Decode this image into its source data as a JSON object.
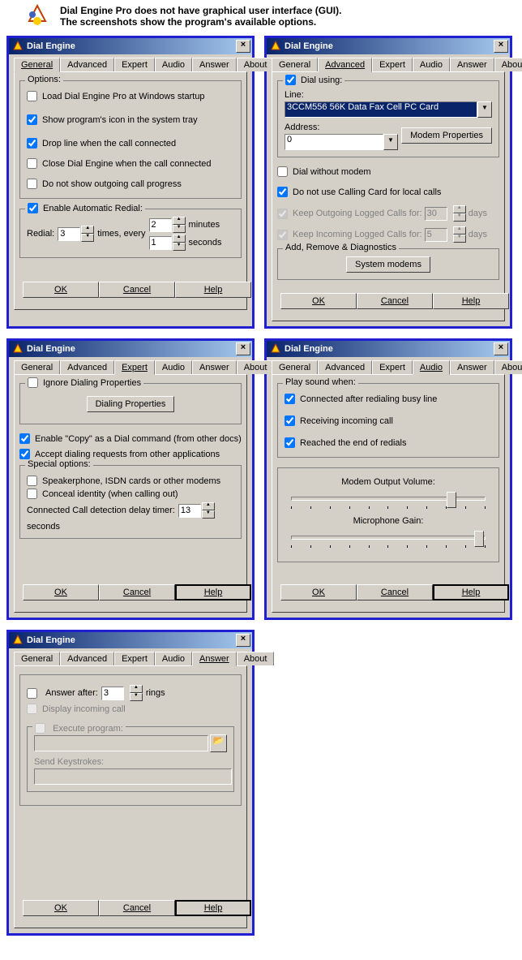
{
  "header": {
    "line1": "Dial Engine Pro does not have graphical user interface (GUI).",
    "line2": "The screenshots show the program's available options."
  },
  "tabs": {
    "general": "General",
    "advanced": "Advanced",
    "expert": "Expert",
    "audio": "Audio",
    "answer": "Answer",
    "about": "About"
  },
  "title": "Dial Engine",
  "buttons": {
    "ok": "OK",
    "cancel": "Cancel",
    "help": "Help"
  },
  "d1": {
    "options_title": "Options:",
    "load": "Load Dial Engine Pro at Windows startup",
    "tray": "Show program's icon in the system tray",
    "dropline": "Drop line when the call connected",
    "close": "Close Dial Engine when the call connected",
    "noshow": "Do not show outgoing call progress",
    "redial_title": "Enable Automatic Redial:",
    "redial_pre": "Redial:",
    "redial_times": "times,  every",
    "minutes": "minutes",
    "seconds": "seconds",
    "redial_count": "3",
    "redial_min": "2",
    "redial_sec": "1"
  },
  "d2": {
    "dialusing": "Dial using:",
    "line": "Line:",
    "line_val": "3CCM556 56K Data Fax Cell PC Card",
    "address": "Address:",
    "address_val": "0",
    "modem_props": "Modem Properties",
    "without": "Dial without modem",
    "nocc": "Do not use Calling Card for local calls",
    "keepout": "Keep Outgoing Logged Calls for:",
    "keepin": "Keep Incoming Logged Calls for:",
    "days": "days",
    "out_days": "30",
    "in_days": "5",
    "diag_title": "Add, Remove & Diagnostics",
    "sysmodems": "System modems"
  },
  "d3": {
    "ignore": "Ignore Dialing Properties",
    "dialprops": "Dialing Properties",
    "copy": "Enable \"Copy\" as a Dial command (from other docs)",
    "accept": "Accept dialing requests from other applications",
    "special_title": "Special options:",
    "speaker": "Speakerphone, ISDN cards or other modems",
    "conceal": "Conceal identity (when calling out)",
    "delay_label": "Connected Call detection delay timer:",
    "delay_val": "13",
    "seconds": "seconds"
  },
  "d4": {
    "play_title": "Play sound when:",
    "connected": "Connected after redialing busy line",
    "receiving": "Receiving incoming call",
    "reached": "Reached the end of redials",
    "modem_vol": "Modem Output Volume:",
    "mic_gain": "Microphone Gain:"
  },
  "d5": {
    "answer_after": "Answer after:",
    "rings": "rings",
    "rings_val": "3",
    "display": "Display incoming call",
    "exec_title": "Execute program:",
    "sendkeys": "Send Keystrokes:"
  }
}
